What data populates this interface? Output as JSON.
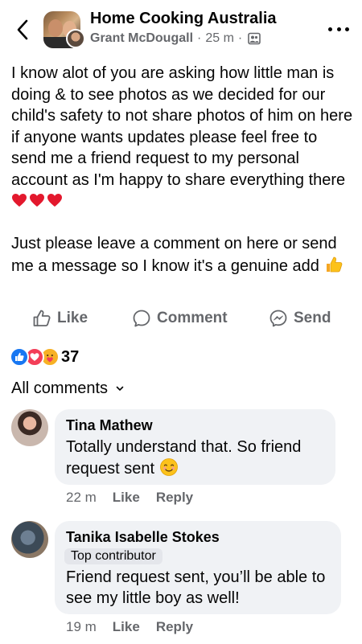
{
  "header": {
    "group_name": "Home Cooking Australia",
    "author": "Grant McDougall",
    "time": "25 m",
    "dot": "·"
  },
  "post": {
    "para1": "I know alot of you are asking how little man is doing & to see photos as we decided for our child's safety to not share photos of him on here if anyone wants updates please feel free to send me a friend request to my personal account as I'm happy to share everything there",
    "para2": "Just please leave a comment on here or send me a message so I know it's a genuine add"
  },
  "actions": {
    "like_label": "Like",
    "comment_label": "Comment",
    "send_label": "Send"
  },
  "reactions": {
    "count": "37",
    "icons": [
      "like-reaction-icon",
      "love-reaction-icon",
      "care-reaction-icon"
    ]
  },
  "filter": {
    "label": "All comments"
  },
  "comments": [
    {
      "name": "Tina Mathew",
      "text": "Totally understand that. So friend request sent",
      "time": "22 m",
      "like": "Like",
      "reply": "Reply"
    },
    {
      "name": "Tanika Isabelle Stokes",
      "badge": "Top contributor",
      "text": "Friend request sent, you’ll be able to see my little boy as well!",
      "time": "19 m",
      "like": "Like",
      "reply": "Reply"
    }
  ],
  "colors": {
    "secondary_text": "#65676b",
    "bubble": "#f0f2f5",
    "like_blue": "#1877f2",
    "love_red": "#f33e58"
  }
}
